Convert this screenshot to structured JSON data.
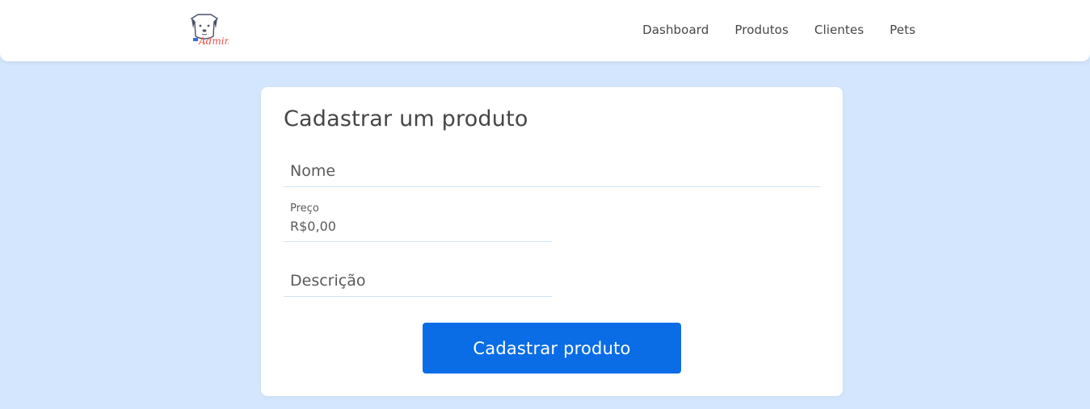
{
  "header": {
    "logo_text": "Admin",
    "nav": [
      "Dashboard",
      "Produtos",
      "Clientes",
      "Pets"
    ]
  },
  "form": {
    "title": "Cadastrar um produto",
    "nome_placeholder": "Nome",
    "preco_label": "Preço",
    "preco_value": "R$0,00",
    "descricao_placeholder": "Descrição",
    "submit_label": "Cadastrar produto"
  },
  "colors": {
    "background": "#d4e6fd",
    "button": "#0a6de6",
    "logo_accent": "#e8524a"
  }
}
